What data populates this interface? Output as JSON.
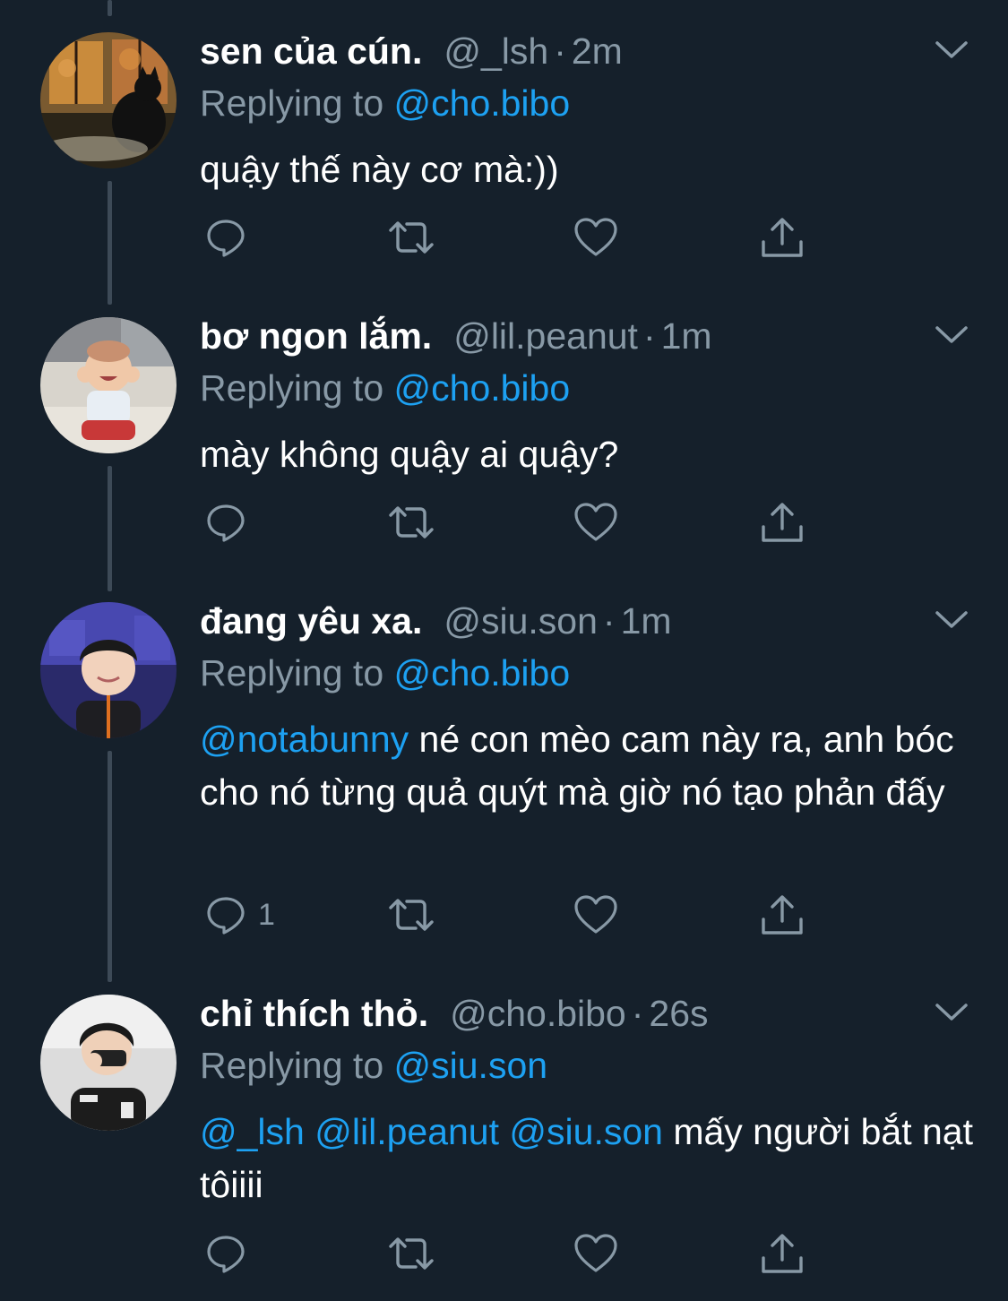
{
  "tweets": [
    {
      "name": "sen của cún.",
      "handle": "@_lsh",
      "separator": "·",
      "time": "2m",
      "replying_prefix": "Replying to ",
      "replying_to": "@cho.bibo",
      "text": "quậy thế này cơ mà:))",
      "reply_count": ""
    },
    {
      "name": "bơ ngon lắm.",
      "handle": "@lil.peanut",
      "separator": "·",
      "time": "1m",
      "replying_prefix": "Replying to ",
      "replying_to": "@cho.bibo",
      "text": "mày không quậy ai quậy?",
      "reply_count": ""
    },
    {
      "name": "đang yêu xa.",
      "handle": "@siu.son",
      "separator": "·",
      "time": "1m",
      "replying_prefix": "Replying to ",
      "replying_to": "@cho.bibo",
      "mention": "@notabunny",
      "text": " né con mèo cam này ra, anh bóc cho nó từng quả quýt mà giờ nó tạo phản đấy",
      "reply_count": "1"
    },
    {
      "name": "chỉ thích thỏ.",
      "handle": "@cho.bibo",
      "separator": "·",
      "time": "26s",
      "replying_prefix": "Replying to ",
      "replying_to": "@siu.son",
      "mentions": [
        "@_lsh",
        "@lil.peanut",
        "@siu.son"
      ],
      "text": " mấy người bắt nạt tôiiii",
      "reply_count": ""
    }
  ],
  "icons": {
    "reply": "reply-icon",
    "retweet": "retweet-icon",
    "like": "heart-icon",
    "share": "share-icon",
    "more": "chevron-down-icon"
  },
  "colors": {
    "background": "#15202b",
    "text": "#ffffff",
    "secondary": "#8899a6",
    "link": "#1da1f2",
    "thread_line": "#3d4a57"
  }
}
